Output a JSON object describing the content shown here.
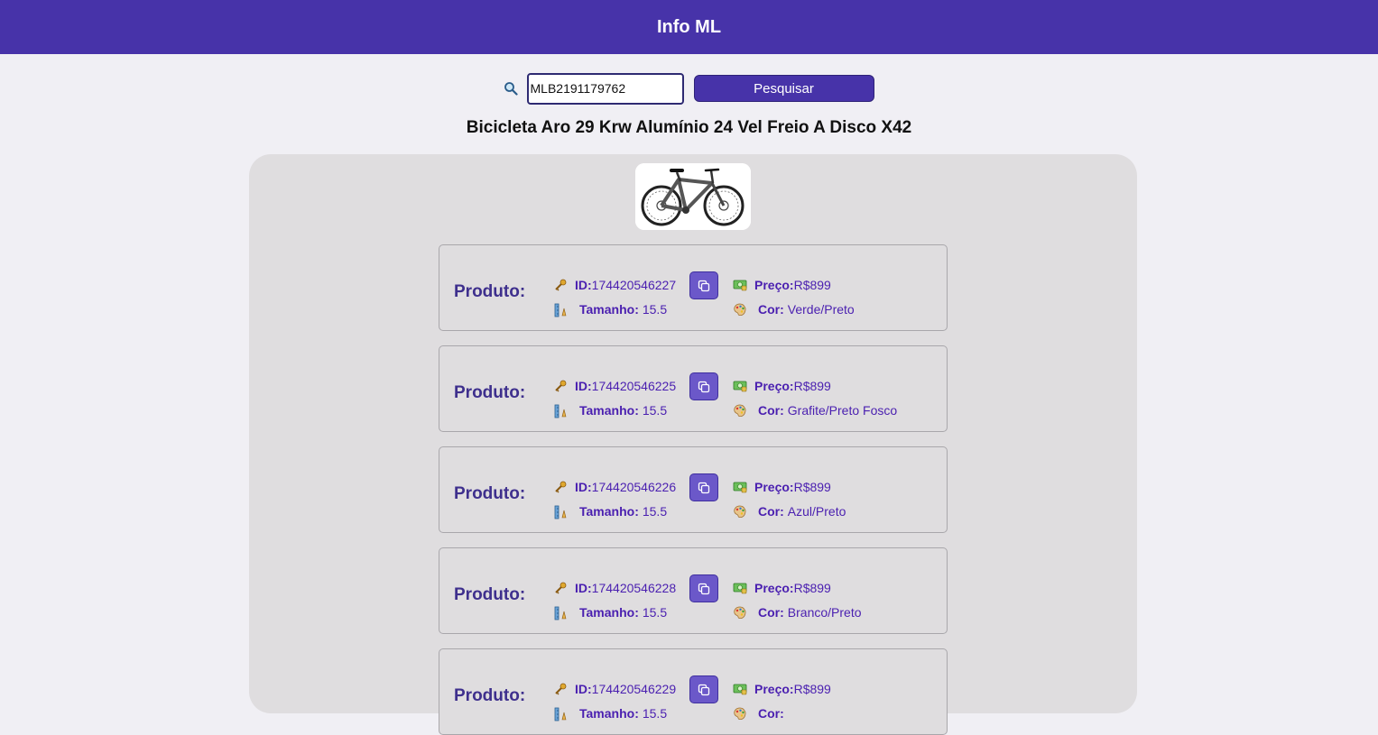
{
  "header": {
    "title": "Info ML"
  },
  "search": {
    "value": "MLB2191179762",
    "button_label": "Pesquisar"
  },
  "product": {
    "title": "Bicicleta Aro 29 Krw Alumínio 24 Vel Freio A Disco X42"
  },
  "cards": [
    {
      "label": "Produto:",
      "id_label": "ID:",
      "id": "174420546227",
      "size_label": "Tamanho:",
      "size": "15.5",
      "price_label": "Preço:",
      "price": "R$899",
      "color_label": "Cor:",
      "color": "Verde/Preto"
    },
    {
      "label": "Produto:",
      "id_label": "ID:",
      "id": "174420546225",
      "size_label": "Tamanho:",
      "size": "15.5",
      "price_label": "Preço:",
      "price": "R$899",
      "color_label": "Cor:",
      "color": "Grafite/Preto Fosco"
    },
    {
      "label": "Produto:",
      "id_label": "ID:",
      "id": "174420546226",
      "size_label": "Tamanho:",
      "size": "15.5",
      "price_label": "Preço:",
      "price": "R$899",
      "color_label": "Cor:",
      "color": "Azul/Preto"
    },
    {
      "label": "Produto:",
      "id_label": "ID:",
      "id": "174420546228",
      "size_label": "Tamanho:",
      "size": "15.5",
      "price_label": "Preço:",
      "price": "R$899",
      "color_label": "Cor:",
      "color": "Branco/Preto"
    },
    {
      "label": "Produto:",
      "id_label": "ID:",
      "id": "174420546229",
      "size_label": "Tamanho:",
      "size": "15.5",
      "price_label": "Preço:",
      "price": "R$899",
      "color_label": "Cor:",
      "color": ""
    }
  ],
  "icons": {
    "search": "magnifier-icon",
    "id": "key-icon",
    "size": "ruler-icon",
    "price": "money-icon",
    "color": "palette-icon",
    "copy": "copy-icon"
  },
  "colors": {
    "accent": "#4733a9",
    "text_accent": "#4a1fb0",
    "panel": "#dfdddf",
    "page": "#f0eff4"
  }
}
